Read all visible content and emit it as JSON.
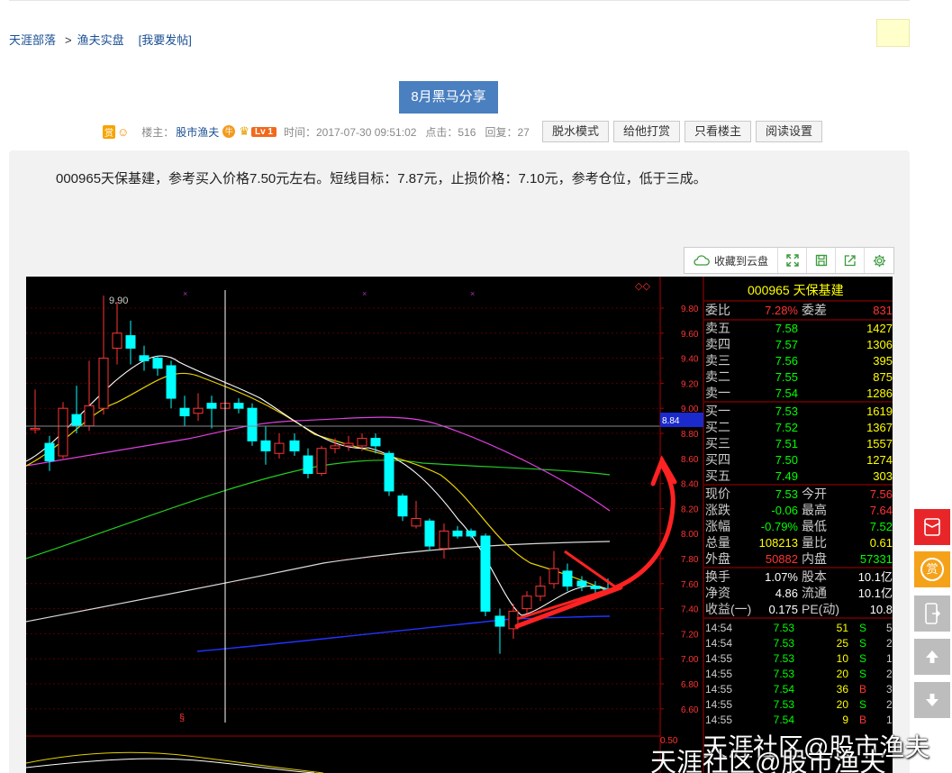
{
  "breadcrumb": {
    "site": "天涯部落",
    "sep": ">",
    "board": "渔夫实盘",
    "post_link": "[我要发帖]"
  },
  "post": {
    "title": "8月黑马分享",
    "shang_badge": "赏",
    "host_label": "楼主：",
    "author": "股市渔夫",
    "niu_badge": "牛",
    "level": "Lv 1",
    "time": "时间：2017-07-30 09:51:02",
    "clicks": "点击：516",
    "replies": "回复：27",
    "body": "000965天保基建，参考买入价格7.50元左右。短线目标：7.87元，止损价格：7.10元，参考仓位，低于三成。"
  },
  "toolbar": {
    "shuishui": "脱水模式",
    "tip": "给他打赏",
    "only_host": "只看楼主",
    "read_settings": "阅读设置"
  },
  "image_toolbar": {
    "save_cloud": "收藏到云盘"
  },
  "chart": {
    "high_marker": "9.90",
    "current_price_tag": "8.84",
    "price_axis": [
      "9.80",
      "9.60",
      "9.40",
      "9.20",
      "9.00",
      "8.80",
      "8.60",
      "8.40",
      "8.20",
      "8.00",
      "7.80",
      "7.60",
      "7.40",
      "7.20",
      "7.00",
      "6.80",
      "6.60"
    ],
    "bottom_axis": "0.50",
    "section_mark": "§",
    "diamond_mark": "◇◇",
    "stock_header": "000965 天保基建",
    "weibi": {
      "label": "委比",
      "value": "7.28%",
      "label2": "委差",
      "value2": "831"
    },
    "sell": [
      {
        "label": "卖五",
        "price": "7.58",
        "vol": "1427"
      },
      {
        "label": "卖四",
        "price": "7.57",
        "vol": "1306"
      },
      {
        "label": "卖三",
        "price": "7.56",
        "vol": "395"
      },
      {
        "label": "卖二",
        "price": "7.55",
        "vol": "875"
      },
      {
        "label": "卖一",
        "price": "7.54",
        "vol": "1286"
      }
    ],
    "buy": [
      {
        "label": "买一",
        "price": "7.53",
        "vol": "1619"
      },
      {
        "label": "买二",
        "price": "7.52",
        "vol": "1367"
      },
      {
        "label": "买三",
        "price": "7.51",
        "vol": "1557"
      },
      {
        "label": "买四",
        "price": "7.50",
        "vol": "1274"
      },
      {
        "label": "买五",
        "price": "7.49",
        "vol": "303"
      }
    ],
    "quote": [
      {
        "l1": "现价",
        "v1": "7.53",
        "l2": "今开",
        "v2": "7.56"
      },
      {
        "l1": "涨跌",
        "v1": "-0.06",
        "l2": "最高",
        "v2": "7.64"
      },
      {
        "l1": "涨幅",
        "v1": "-0.79%",
        "l2": "最低",
        "v2": "7.52"
      },
      {
        "l1": "总量",
        "v1": "108213",
        "l2": "量比",
        "v2": "0.61"
      },
      {
        "l1": "外盘",
        "v1": "50882",
        "l2": "内盘",
        "v2": "57331"
      }
    ],
    "fund": [
      {
        "l1": "换手",
        "v1": "1.07%",
        "l2": "股本",
        "v2": "10.1亿"
      },
      {
        "l1": "净资",
        "v1": "4.86",
        "l2": "流通",
        "v2": "10.1亿"
      },
      {
        "l1": "收益(一)",
        "v1": "0.175",
        "l2": "PE(动)",
        "v2": "10.8"
      }
    ],
    "ticks": [
      {
        "t": "14:54",
        "p": "7.53",
        "v": "51",
        "s": "S",
        "n": "5"
      },
      {
        "t": "14:54",
        "p": "7.53",
        "v": "25",
        "s": "S",
        "n": "2"
      },
      {
        "t": "14:55",
        "p": "7.53",
        "v": "10",
        "s": "S",
        "n": "1"
      },
      {
        "t": "14:55",
        "p": "7.53",
        "v": "20",
        "s": "S",
        "n": "2"
      },
      {
        "t": "14:55",
        "p": "7.54",
        "v": "36",
        "s": "B",
        "n": "3"
      },
      {
        "t": "14:55",
        "p": "7.53",
        "v": "20",
        "s": "S",
        "n": "2"
      },
      {
        "t": "14:55",
        "p": "7.54",
        "v": "9",
        "s": "B",
        "n": "1"
      }
    ]
  },
  "side": {
    "hongbao": "红包",
    "shang": "赏"
  },
  "watermark": "天涯社区@股市渔夫",
  "colors": {
    "title_bg": "#4a7fc0",
    "link": "#1a4f93",
    "up": "#ff3333",
    "down": "#00ffff",
    "chart_bg": "#000000"
  }
}
